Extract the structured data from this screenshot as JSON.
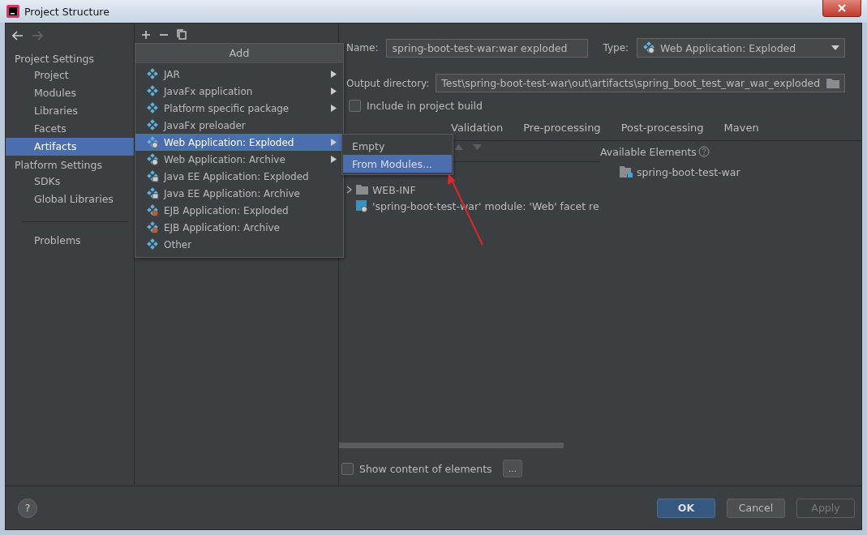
{
  "window": {
    "title": "Project Structure"
  },
  "sidebar": {
    "sections": [
      {
        "heading": "Project Settings",
        "items": [
          {
            "label": "Project",
            "selected": false
          },
          {
            "label": "Modules",
            "selected": false
          },
          {
            "label": "Libraries",
            "selected": false
          },
          {
            "label": "Facets",
            "selected": false
          },
          {
            "label": "Artifacts",
            "selected": true
          }
        ]
      },
      {
        "heading": "Platform Settings",
        "items": [
          {
            "label": "SDKs",
            "selected": false
          },
          {
            "label": "Global Libraries",
            "selected": false
          }
        ]
      }
    ],
    "problems": "Problems"
  },
  "add_menu": {
    "title": "Add",
    "items": [
      {
        "label": "JAR",
        "kind": "artifact",
        "submenu": true,
        "selected": false
      },
      {
        "label": "JavaFx application",
        "kind": "artifact",
        "submenu": true,
        "selected": false
      },
      {
        "label": "Platform specific package",
        "kind": "artifact",
        "submenu": true,
        "selected": false
      },
      {
        "label": "JavaFx preloader",
        "kind": "artifact",
        "submenu": false,
        "selected": false
      },
      {
        "label": "Web Application: Exploded",
        "kind": "web",
        "submenu": true,
        "selected": true
      },
      {
        "label": "Web Application: Archive",
        "kind": "web",
        "submenu": true,
        "selected": false
      },
      {
        "label": "Java EE Application: Exploded",
        "kind": "javaee",
        "submenu": false,
        "selected": false
      },
      {
        "label": "Java EE Application: Archive",
        "kind": "javaee",
        "submenu": false,
        "selected": false
      },
      {
        "label": "EJB Application: Exploded",
        "kind": "ejb",
        "submenu": false,
        "selected": false
      },
      {
        "label": "EJB Application: Archive",
        "kind": "ejb",
        "submenu": false,
        "selected": false
      },
      {
        "label": "Other",
        "kind": "artifact",
        "submenu": false,
        "selected": false
      }
    ]
  },
  "submenu": {
    "items": [
      {
        "label": "Empty",
        "selected": false
      },
      {
        "label": "From Modules...",
        "selected": true
      }
    ]
  },
  "artifact": {
    "name_label": "Name:",
    "name": "spring-boot-test-war:war exploded",
    "type_label": "Type:",
    "type": "Web Application: Exploded",
    "output_label": "Output directory:",
    "output": "Test\\spring-boot-test-war\\out\\artifacts\\spring_boot_test_war_war_exploded",
    "include": {
      "label": "Include in project build",
      "checked": false
    }
  },
  "tabs": [
    {
      "label": "Validation",
      "selected": false
    },
    {
      "label": "Pre-processing",
      "selected": false
    },
    {
      "label": "Post-processing",
      "selected": false
    },
    {
      "label": "Maven",
      "selected": false
    }
  ],
  "layout_tree": [
    {
      "label": "WEB-INF",
      "kind": "folder",
      "expanded": false
    },
    {
      "label": "'spring-boot-test-war' module: 'Web' facet re",
      "kind": "module"
    }
  ],
  "available": {
    "title": "Available Elements",
    "items": [
      {
        "label": "spring-boot-test-war"
      }
    ]
  },
  "show_content": {
    "label": "Show content of elements",
    "checked": false
  },
  "more_button": "...",
  "help": "?",
  "buttons": [
    {
      "label": "OK",
      "kind": "default",
      "disabled": false
    },
    {
      "label": "Cancel",
      "kind": "normal",
      "disabled": false
    },
    {
      "label": "Apply",
      "kind": "normal",
      "disabled": true
    }
  ]
}
